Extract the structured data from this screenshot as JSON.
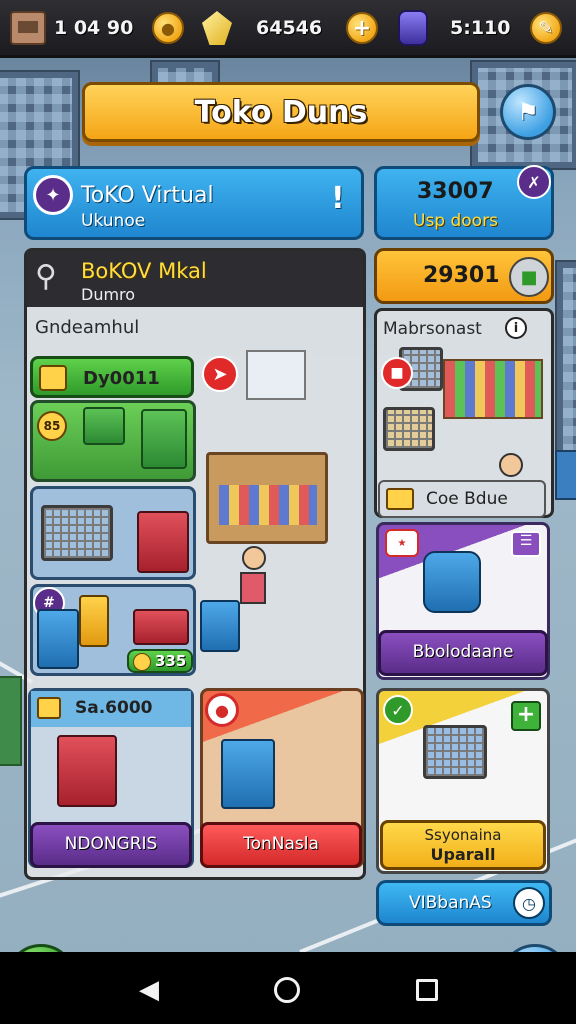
{
  "topbar": {
    "resource1": {
      "value": "1 04 90",
      "icon": "crate-icon"
    },
    "resource2": {
      "value": "64546",
      "icon": "gem-icon"
    },
    "resource3": {
      "value": "5:110",
      "icon": "potion-icon"
    }
  },
  "banner": {
    "title": "Toko Duns"
  },
  "store_panel": {
    "title": "ToKO Virtual",
    "subtitle": "Ukunoe",
    "alert": "!"
  },
  "stats_panel": {
    "value": "33007",
    "label": "Usp doors"
  },
  "coins_panel": {
    "value": "29301"
  },
  "market_panel": {
    "title": "BoKOV Mkal",
    "subtitle": "Dumro"
  },
  "left_section": {
    "title": "Gndeamhul"
  },
  "right_section": {
    "title": "Mabrsonast",
    "info": "i"
  },
  "tiles": {
    "tile1": {
      "label": "Dy0011"
    },
    "tile1_badge": "85",
    "tile_cost": "335",
    "price_tile": {
      "label": "Sa.6000"
    }
  },
  "buttons": {
    "ndongris": "NDONGRIS",
    "tonnasla": "TonNasla",
    "bbolodaane": "Bbolodaane",
    "upgrade_line1": "Ssyonaina",
    "upgrade_line2": "Uparall",
    "vibbanas": "VIBbanAS",
    "coe_bdue": "Coe Bdue"
  },
  "colors": {
    "accent_yellow": "#f5a516",
    "accent_blue": "#1f86cf",
    "accent_green": "#3f9a36",
    "accent_purple": "#5a2d8a",
    "accent_red": "#d42a2a"
  }
}
